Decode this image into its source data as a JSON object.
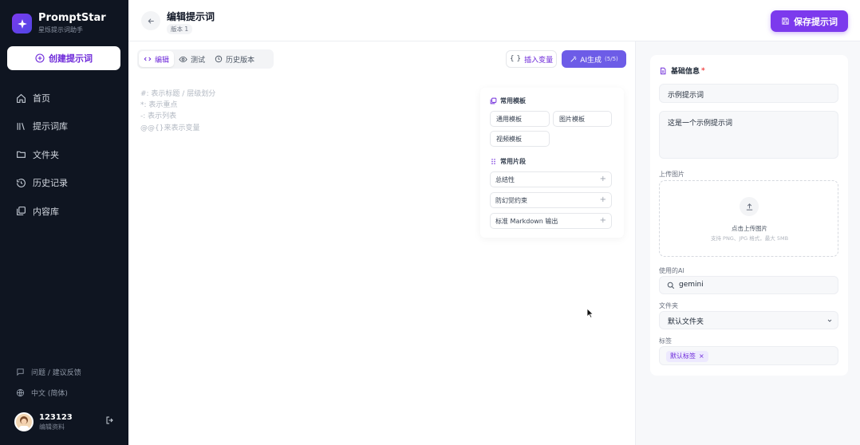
{
  "brand": {
    "name": "PromptStar",
    "subtitle": "星烁提示词助手"
  },
  "sidebar": {
    "create_label": "创建提示词",
    "items": [
      {
        "label": "首页",
        "icon": "home-icon"
      },
      {
        "label": "提示词库",
        "icon": "library-icon"
      },
      {
        "label": "文件夹",
        "icon": "folder-icon"
      },
      {
        "label": "历史记录",
        "icon": "history-icon"
      },
      {
        "label": "内容库",
        "icon": "content-library-icon"
      }
    ],
    "feedback": "问题 / 建议反馈",
    "language": "中文 (简体)",
    "user": {
      "name": "123123",
      "subtitle": "编辑资料"
    }
  },
  "header": {
    "title": "编辑提示词",
    "version": "版本 1",
    "save_label": "保存提示词"
  },
  "editor": {
    "tabs": [
      {
        "label": "编辑",
        "icon": "code-icon",
        "active": true
      },
      {
        "label": "测试",
        "icon": "eye-icon",
        "active": false
      },
      {
        "label": "历史版本",
        "icon": "clock-icon",
        "active": false
      }
    ],
    "insert_variable_label": "插入变量",
    "ai_generate_label": "AI生成",
    "ai_generate_count": "(5/5)",
    "placeholder_lines": [
      "#: 表示标题  /  层级划分",
      "*: 表示重点",
      "-: 表示列表",
      "@@{}来表示变量"
    ],
    "templates_heading": "常用模板",
    "templates": [
      "通用模板",
      "图片模板",
      "视频模板"
    ],
    "snippets_heading": "常用片段",
    "snippets": [
      "总结性",
      "防幻觉约束",
      "标准 Markdown 输出"
    ]
  },
  "info": {
    "title": "基础信息",
    "required_mark": "*",
    "name_value": "示例提示词",
    "description_value": "这是一个示例提示词",
    "upload_label": "上传图片",
    "upload_text": "点击上传图片",
    "upload_hint": "支持 PNG、JPG 格式，最大 5MB",
    "ai_label": "使用的AI",
    "ai_value": "gemini",
    "folder_label": "文件夹",
    "folder_value": "默认文件夹",
    "tags_label": "标签",
    "tags": [
      "默认标签"
    ]
  },
  "colors": {
    "accent": "#7c3aed",
    "sidebar_bg": "#0f1521",
    "ai_button": "#6d5ce7"
  }
}
